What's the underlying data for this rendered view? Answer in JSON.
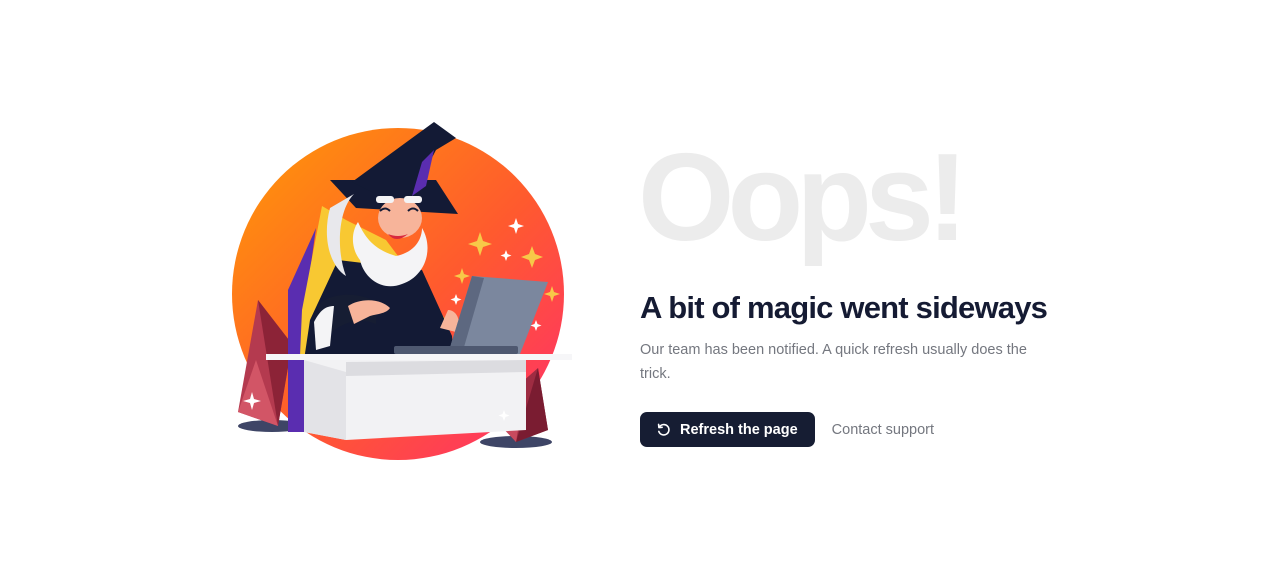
{
  "error": {
    "big_word": "Oops!",
    "heading": "A bit of magic went sideways",
    "message": "Our team has been notified. A quick refresh usually does the trick."
  },
  "actions": {
    "refresh_label": "Refresh the page",
    "refresh_icon": "refresh-icon",
    "support_label": "Contact support"
  },
  "illustration": {
    "name": "wizard-at-laptop",
    "colors": {
      "circle_start": "#ff8a0c",
      "circle_end": "#ff3568",
      "hat": "#131a35",
      "robe_lining": "#f8c832",
      "robe_trim": "#5a2db0",
      "laptop": "#6f7b92",
      "crystal": "#b43a4f",
      "sparkle": "#f7c948"
    }
  },
  "theme": {
    "primary": "#161d33",
    "heading_color": "#151b33",
    "muted_text": "#74777f",
    "big_word_color": "#ececec"
  }
}
